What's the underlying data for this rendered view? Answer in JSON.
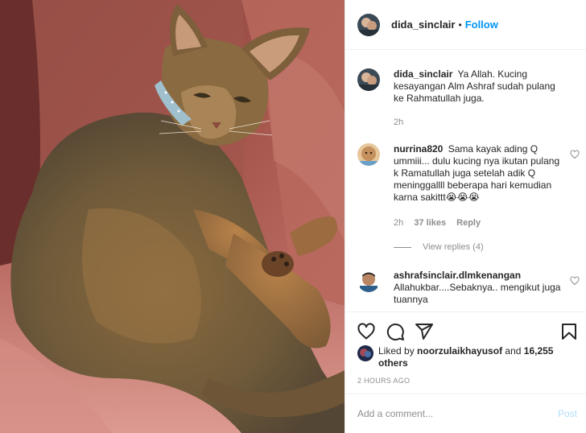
{
  "photo": {
    "alt": "Abyssinian cat lying on a red armchair",
    "icon": "cat-photo"
  },
  "header": {
    "username": "dida_sinclair",
    "separator": "•",
    "follow_label": "Follow"
  },
  "comments": [
    {
      "username": "dida_sinclair",
      "text": "Ya Allah. Kucing kesayangan Alm Ashraf sudah pulang ke Rahmatullah juga.",
      "time": "2h"
    },
    {
      "username": "nurrina820",
      "text": "Sama kayak ading Q ummiii... dulu kucing nya ikutan pulang k Ramatullah juga setelah adik Q meninggallll beberapa hari kemudian karna sakittt😭😭😭",
      "time": "2h",
      "likes": "37 likes",
      "reply_label": "Reply",
      "view_replies": "View replies (4)"
    },
    {
      "username": "ashrafsinclair.dlmkenangan",
      "text": "Allahukbar....Sebaknya.. mengikut juga tuannya"
    }
  ],
  "likes": {
    "prefix": "Liked by",
    "liker": "noorzulaikhayusof",
    "and": "and",
    "others": "16,255 others"
  },
  "timestamp": "2 HOURS AGO",
  "add_comment": {
    "placeholder": "Add a comment...",
    "post_label": "Post"
  },
  "colors": {
    "accent": "#0095f6",
    "post_disabled": "#b2dffc",
    "muted": "#8e8e8e",
    "text": "#262626",
    "border": "#efefef"
  },
  "icons": [
    "heart-icon",
    "comment-icon",
    "share-icon",
    "bookmark-icon",
    "small-heart-icon"
  ]
}
